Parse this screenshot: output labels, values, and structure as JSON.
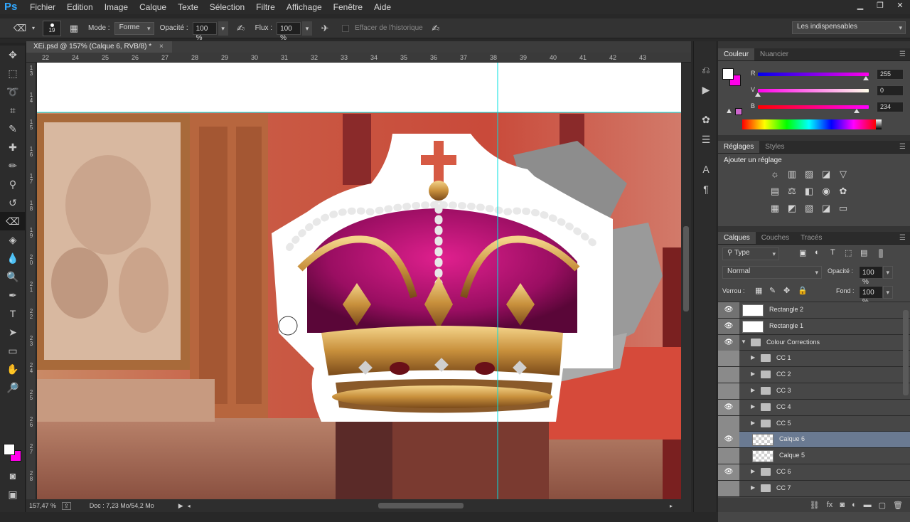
{
  "app": {
    "logo": "Ps"
  },
  "menu": [
    "Fichier",
    "Edition",
    "Image",
    "Calque",
    "Texte",
    "Sélection",
    "Filtre",
    "Affichage",
    "Fenêtre",
    "Aide"
  ],
  "window_controls": {
    "minimize": "▁",
    "restore": "❐",
    "close": "✕"
  },
  "options_bar": {
    "brush_size": "19",
    "mode_label": "Mode :",
    "mode_value": "Forme",
    "opacity_label": "Opacité :",
    "opacity_value": "100 %",
    "flux_label": "Flux :",
    "flux_value": "100 %",
    "history_label": "Effacer de l'historique",
    "workspace_value": "Les indispensables"
  },
  "document": {
    "tab_title": "XEi.psd @ 157% (Calque 6, RVB/8) *",
    "tab_close": "×",
    "ruler_top": [
      "22",
      "24",
      "25",
      "26",
      "27",
      "28",
      "29",
      "30",
      "31",
      "32",
      "33",
      "34",
      "35",
      "36",
      "37",
      "38",
      "39",
      "40",
      "41",
      "42",
      "43"
    ],
    "ruler_left": [
      "1 3",
      "1 4",
      "1 5",
      "1 6",
      "1 7",
      "1 8",
      "1 9",
      "2 0",
      "2 1",
      "2 2",
      "2 3",
      "2 4",
      "2 5",
      "2 6",
      "2 7",
      "2 8"
    ]
  },
  "status": {
    "zoom": "157,47 %",
    "doc_info": "Doc : 7,23 Mo/54,2 Mo"
  },
  "tools": [
    "move-icon",
    "marquee-icon",
    "lasso-icon",
    "crop-icon",
    "eyedropper-icon",
    "healing-icon",
    "brush-icon",
    "stamp-icon",
    "history-brush-icon",
    "eraser-icon",
    "bucket-icon",
    "blur-icon",
    "dodge-icon",
    "pen-icon",
    "type-icon",
    "path-select-icon",
    "shape-icon",
    "hand-icon",
    "zoom-icon"
  ],
  "tool_glyphs": [
    "✥",
    "⬚",
    "➰",
    "⌗",
    "✎",
    "✚",
    "✏",
    "⚲",
    "↺",
    "⌫",
    "◈",
    "💧",
    "🔍",
    "✒",
    "T",
    "➤",
    "▭",
    "✋",
    "🔎"
  ],
  "color_panel": {
    "tabs": [
      "Couleur",
      "Nuancier"
    ],
    "channels": [
      {
        "label": "R",
        "value": "255",
        "color": "#ff00ea"
      },
      {
        "label": "V",
        "value": "0",
        "color": "#ff00ea"
      },
      {
        "label": "B",
        "value": "234",
        "color": "#ff00ea"
      }
    ],
    "foreground": "#ffffff",
    "background": "#ff00ea"
  },
  "adjustments_panel": {
    "tabs": [
      "Réglages",
      "Styles"
    ],
    "title": "Ajouter un réglage"
  },
  "layers_panel": {
    "tabs": [
      "Calques",
      "Couches",
      "Tracés"
    ],
    "filter_value": "Type",
    "blend_value": "Normal",
    "opacity_label": "Opacité :",
    "opacity_value": "100 %",
    "lock_label": "Verrou :",
    "fill_label": "Fond :",
    "fill_value": "100 %",
    "layers": [
      {
        "name": "Rectangle 2",
        "visible": true,
        "kind": "shape",
        "indent": 0
      },
      {
        "name": "Rectangle 1",
        "visible": true,
        "kind": "shape",
        "indent": 0
      },
      {
        "name": "Colour Corrections",
        "visible": true,
        "kind": "group-open",
        "indent": 0
      },
      {
        "name": "CC 1",
        "visible": false,
        "kind": "group",
        "indent": 1
      },
      {
        "name": "CC 2",
        "visible": false,
        "kind": "group",
        "indent": 1
      },
      {
        "name": "CC 3",
        "visible": false,
        "kind": "group",
        "indent": 1
      },
      {
        "name": "CC 4",
        "visible": true,
        "kind": "group",
        "indent": 1
      },
      {
        "name": "CC 5",
        "visible": false,
        "kind": "group",
        "indent": 1
      },
      {
        "name": "Calque 6",
        "visible": true,
        "kind": "pixel",
        "indent": 1,
        "selected": true
      },
      {
        "name": "Calque 5",
        "visible": false,
        "kind": "pixel",
        "indent": 1
      },
      {
        "name": "CC 6",
        "visible": true,
        "kind": "group",
        "indent": 1
      },
      {
        "name": "CC 7",
        "visible": false,
        "kind": "group",
        "indent": 1
      }
    ]
  }
}
